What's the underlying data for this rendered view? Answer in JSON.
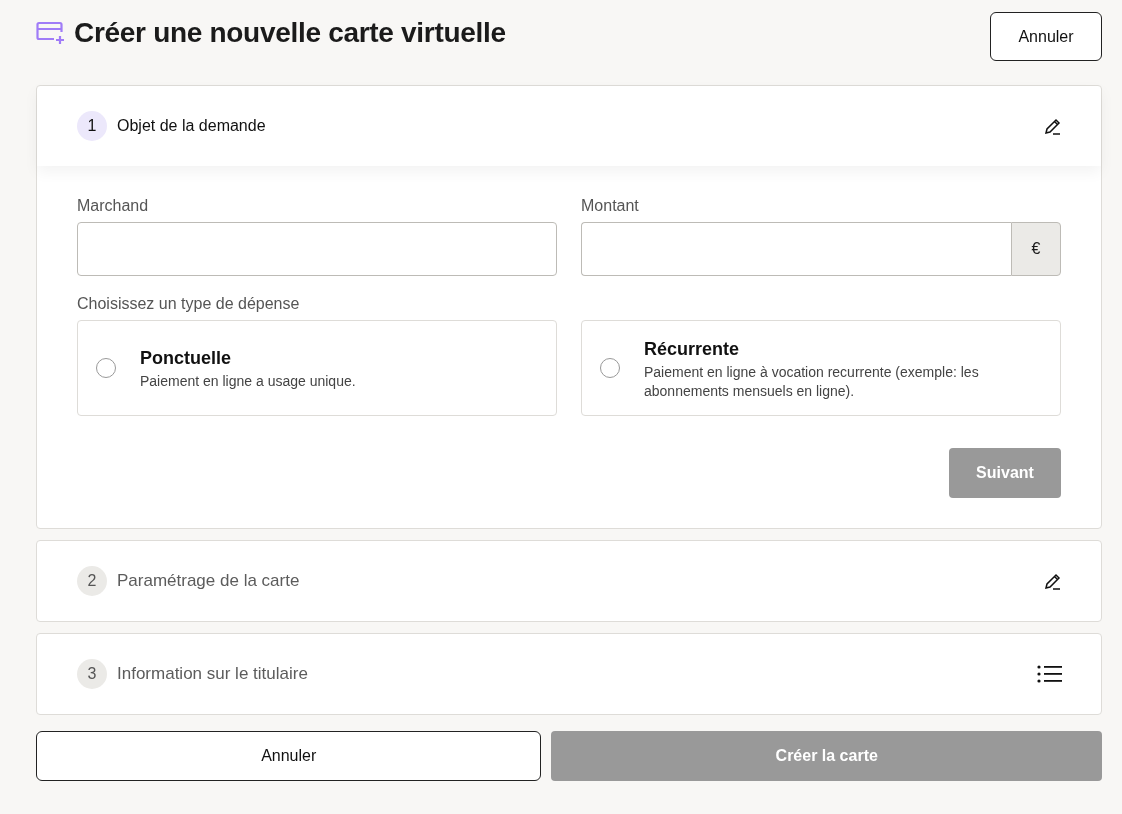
{
  "header": {
    "title": "Créer une nouvelle carte virtuelle",
    "cancel": "Annuler"
  },
  "steps": [
    {
      "number": "1",
      "title": "Objet de la demande",
      "active": true,
      "kind": "edit"
    },
    {
      "number": "2",
      "title": "Paramétrage de la carte",
      "active": false,
      "kind": "edit"
    },
    {
      "number": "3",
      "title": "Information sur le titulaire",
      "active": false,
      "kind": "list"
    }
  ],
  "form": {
    "fields": [
      {
        "label": "Marchand"
      },
      {
        "label": "Montant",
        "suffix": "€"
      }
    ],
    "expense_label": "Choisissez un type de dépense",
    "expense_types": [
      {
        "title": "Ponctuelle",
        "description": "Paiement en ligne a usage unique.",
        "selected": false
      },
      {
        "title": "Récurrente",
        "description": "Paiement en ligne à vocation recurrente (exemple: les abonnements mensuels en ligne).",
        "selected": false
      }
    ],
    "next": {
      "label": "Suivant",
      "disabled": true
    }
  },
  "footer": {
    "cancel": "Annuler",
    "create": {
      "label": "Créer la carte",
      "disabled": true
    }
  }
}
